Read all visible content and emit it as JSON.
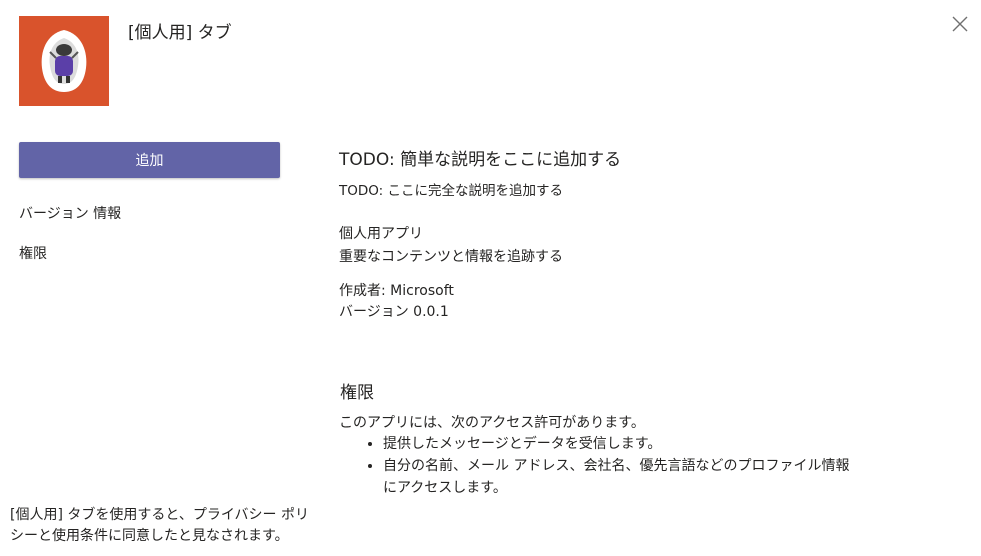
{
  "header": {
    "app_title": "[個人用] タブ",
    "close_icon": "close-icon",
    "app_icon_color": "#d9532c"
  },
  "sidebar": {
    "add_button_label": "追加",
    "add_button_color": "#6264a7",
    "links": [
      "バージョン 情報",
      "権限"
    ]
  },
  "details": {
    "short_description": "TODO: 簡単な説明をここに追加する",
    "full_description": "TODO: ここに完全な説明を追加する",
    "personal_app_title": "個人用アプリ",
    "personal_app_desc": "重要なコンテンツと情報を追跡する",
    "developer": "作成者: Microsoft",
    "version": "バージョン 0.0.1"
  },
  "permissions": {
    "heading": "権限",
    "intro": "このアプリには、次のアクセス許可があります。",
    "items": [
      "提供したメッセージとデータを受信します。",
      "自分の名前、メール アドレス、会社名、優先言語などのプロファイル情報にアクセスします。"
    ]
  },
  "footer": {
    "consent_text": "[個人用] タブを使用すると、プライバシー ポリシーと使用条件に同意したと見なされます。"
  }
}
